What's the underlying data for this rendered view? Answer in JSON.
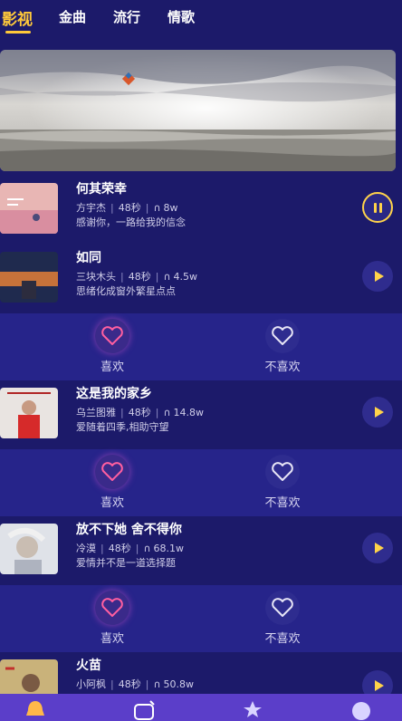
{
  "tabs": [
    {
      "label": "影视",
      "active": true
    },
    {
      "label": "金曲",
      "active": false
    },
    {
      "label": "流行",
      "active": false
    },
    {
      "label": "情歌",
      "active": false
    }
  ],
  "colors": {
    "background": "#1c1a6a",
    "accent": "#ffc93a",
    "like_bar": "#26248a",
    "bottom_nav": "#5b3ec9"
  },
  "songs": [
    {
      "title": "何其荣幸",
      "artist": "方宇杰",
      "duration": "48秒",
      "plays": "8w",
      "desc": "感谢你，一路给我的信念",
      "state": "pause"
    },
    {
      "title": "如同",
      "artist": "三块木头",
      "duration": "48秒",
      "plays": "4.5w",
      "desc": "思绪化成窗外繁星点点",
      "state": "play"
    },
    {
      "title": "这是我的家乡",
      "artist": "乌兰图雅",
      "duration": "48秒",
      "plays": "14.8w",
      "desc": "爱随着四季,相助守望",
      "state": "play"
    },
    {
      "title": "放不下她 舍不得你",
      "artist": "冷漠",
      "duration": "48秒",
      "plays": "68.1w",
      "desc": "爱情并不是一道选择题",
      "state": "play"
    },
    {
      "title": "火苗",
      "artist": "小阿枫",
      "duration": "48秒",
      "plays": "50.8w",
      "desc": "",
      "state": "play"
    }
  ],
  "reactions": {
    "like_label": "喜欢",
    "dislike_label": "不喜欢"
  },
  "bottom_nav": [
    {
      "icon": "bell-icon"
    },
    {
      "icon": "music-note-icon"
    },
    {
      "icon": "star-icon"
    },
    {
      "icon": "smile-icon"
    }
  ]
}
